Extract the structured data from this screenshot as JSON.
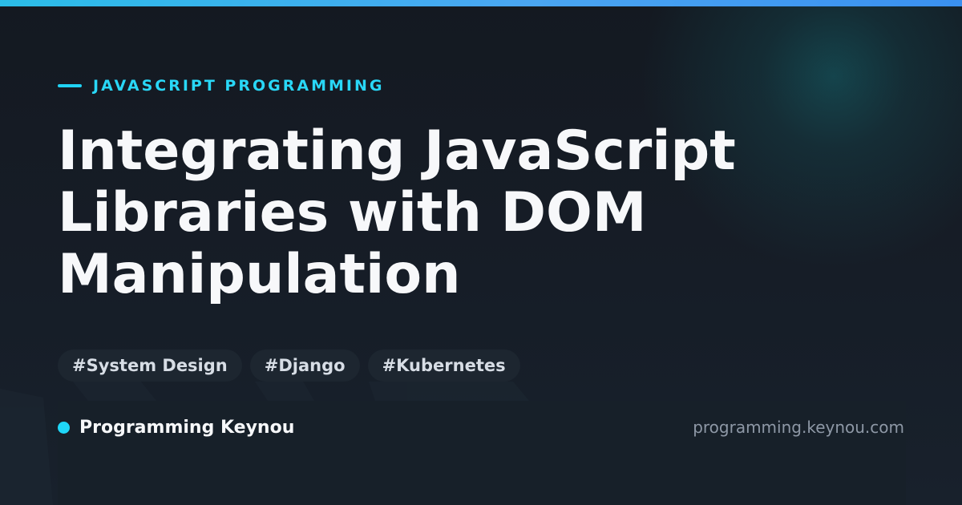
{
  "colors": {
    "accent": "#20d2f4",
    "top_bar": "#3aa6f0",
    "title": "#f7f8fa",
    "tag_background": "#1d2630",
    "background": "#141922"
  },
  "header": {
    "category": "JAVASCRIPT PROGRAMMING",
    "title_lines": [
      "Integrating JavaScript",
      "Libraries with DOM",
      "Manipulation"
    ]
  },
  "tags": [
    "#System Design",
    "#Django",
    "#Kubernetes"
  ],
  "footer": {
    "brand": "Programming Keynou",
    "url": "programming.keynou.com"
  },
  "icons": {
    "category": "accent-line-icon",
    "brand": "status-dot-icon"
  }
}
